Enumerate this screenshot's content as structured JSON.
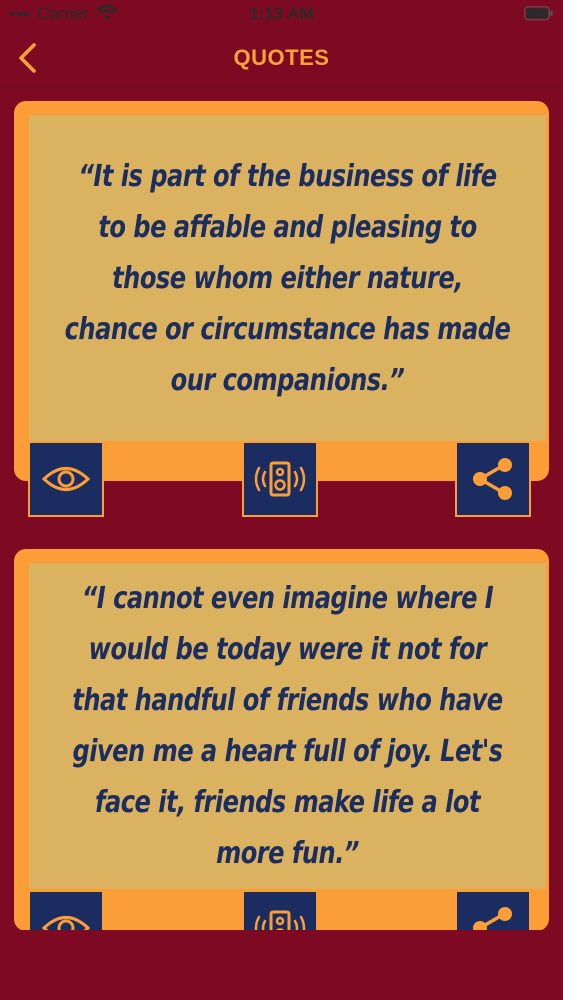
{
  "status_bar": {
    "carrier": "Carrier",
    "time": "1:13 AM"
  },
  "nav": {
    "title": "QUOTES",
    "back_icon": "chevron-left-icon"
  },
  "colors": {
    "background": "#7d0a22",
    "accent": "#fb9e37",
    "quote_panel": "#dbb25f",
    "quote_text": "#1c2d5f",
    "action_button": "#1b2c60"
  },
  "quotes": [
    {
      "text": "“It is part of the business of life to be affable and pleasing to those whom either nature, chance or circumstance has made our companions.”",
      "actions": [
        "eye-icon",
        "speaker-icon",
        "share-icon"
      ]
    },
    {
      "text": "“I cannot even imagine where I would be today were it not for that handful of friends who have given me a heart full of joy. Let's face it, friends make life a lot more fun.”",
      "actions": [
        "eye-icon",
        "speaker-icon",
        "share-icon"
      ]
    }
  ]
}
